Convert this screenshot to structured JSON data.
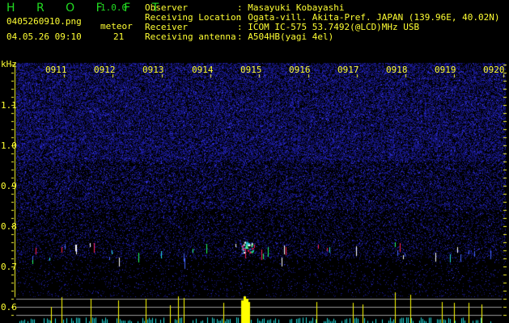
{
  "app": {
    "name": "H R O F F T",
    "version": "1.0.0"
  },
  "file": {
    "name": "0405260910.png",
    "datetime": "04.05.26 09:10"
  },
  "meteor": {
    "label": "meteor",
    "count": "21"
  },
  "info": [
    {
      "label": "Observer",
      "value": ": Masayuki Kobayashi"
    },
    {
      "label": "Receiving Location",
      "value": ": Ogata-vill. Akita-Pref. JAPAN (139.96E, 40.02N)"
    },
    {
      "label": "Receiver",
      "value": ": ICOM IC-575 53.7492(@LCD)MHz USB"
    },
    {
      "label": "Receiving antenna",
      "value": ": A504HB(yagi 4el)"
    }
  ],
  "axis": {
    "y_unit": "kHz",
    "y_ticks": [
      "1.1",
      "1.0",
      "0.9",
      "0.8",
      "0.7",
      "0.6"
    ],
    "x_ticks": [
      "0911",
      "0912",
      "0913",
      "0914",
      "0915",
      "0916",
      "0917",
      "0918",
      "0919",
      "0920"
    ]
  },
  "colors": {
    "text": "#ffff33",
    "logo": "#22dd22",
    "noise": "#1a1aa0",
    "histogram_low": "#22dddd",
    "histogram_high": "#ffff00",
    "grid": "#999999"
  }
}
